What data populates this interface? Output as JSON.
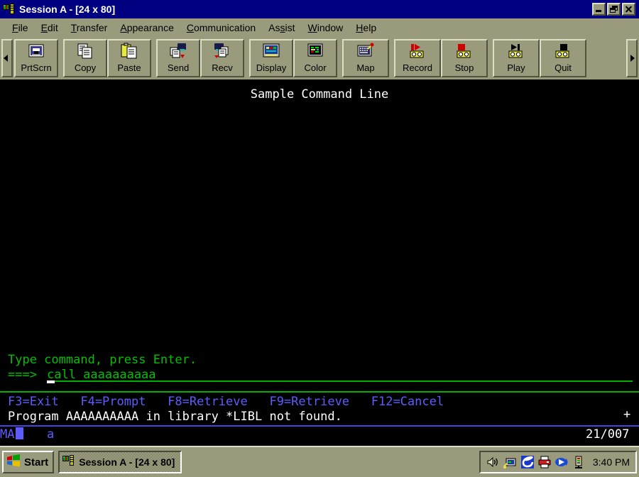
{
  "window": {
    "title": "Session A - [24 x 80]",
    "icon": "session-icon",
    "buttons": {
      "minimize": "minimize-button",
      "restore": "restore-button",
      "close": "close-button"
    }
  },
  "menubar": {
    "items": [
      {
        "label": "File",
        "accel": "F"
      },
      {
        "label": "Edit",
        "accel": "E"
      },
      {
        "label": "Transfer",
        "accel": "T"
      },
      {
        "label": "Appearance",
        "accel": "A"
      },
      {
        "label": "Communication",
        "accel": "C"
      },
      {
        "label": "Assist",
        "accel": "s"
      },
      {
        "label": "Window",
        "accel": "W"
      },
      {
        "label": "Help",
        "accel": "H"
      }
    ]
  },
  "toolbar": {
    "scroll_left": "◀",
    "scroll_right": "▶",
    "groups": [
      {
        "buttons": [
          {
            "label": "PrtScrn",
            "icon": "print-screen-icon"
          }
        ]
      },
      {
        "buttons": [
          {
            "label": "Copy",
            "icon": "copy-icon"
          },
          {
            "label": "Paste",
            "icon": "paste-icon"
          }
        ]
      },
      {
        "buttons": [
          {
            "label": "Send",
            "icon": "send-icon"
          },
          {
            "label": "Recv",
            "icon": "receive-icon"
          }
        ]
      },
      {
        "buttons": [
          {
            "label": "Display",
            "icon": "display-icon"
          },
          {
            "label": "Color",
            "icon": "color-icon"
          }
        ]
      },
      {
        "buttons": [
          {
            "label": "Map",
            "icon": "keyboard-map-icon"
          }
        ]
      },
      {
        "buttons": [
          {
            "label": "Record",
            "icon": "record-icon"
          },
          {
            "label": "Stop",
            "icon": "stop-icon"
          }
        ]
      },
      {
        "buttons": [
          {
            "label": "Play",
            "icon": "play-icon"
          },
          {
            "label": "Quit",
            "icon": "quit-icon"
          }
        ]
      }
    ]
  },
  "terminal": {
    "screen_title": "Sample Command Line",
    "prompt_text": "Type command, press Enter.",
    "prompt_arrow": "===>",
    "command_value": "call aaaaaaaaaa",
    "function_keys": "F3=Exit   F4=Prompt   F8=Retrieve   F9=Retrieve   F12=Cancel",
    "message": "Program AAAAAAAAAA in library *LIBL not found.",
    "more_indicator": "+",
    "colors": {
      "background": "#000000",
      "normal": "#ffffff",
      "input": "#00c000",
      "function_keys": "#5c5cff",
      "rule": "#00b000"
    }
  },
  "status_bar": {
    "system_indicator": "MA",
    "input_indicator": "a",
    "cursor_position": "21/007"
  },
  "taskbar": {
    "start_label": "Start",
    "start_icon": "windows-logo-icon",
    "tasks": [
      {
        "label": "Session A - [24 x 80]",
        "icon": "session-icon",
        "active": true
      }
    ],
    "tray_icons": [
      "volume-icon",
      "network-monitor-icon",
      "internet-explorer-icon",
      "printer-icon",
      "media-player-icon",
      "device-icon"
    ],
    "clock": "3:40 PM"
  }
}
